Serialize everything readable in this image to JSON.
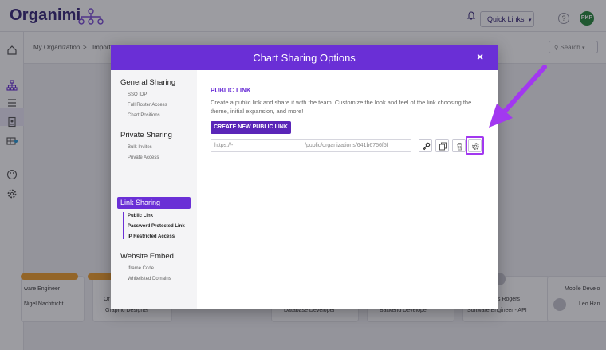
{
  "app": {
    "logo_text": "Organimi",
    "quick_links_label": "Quick Links",
    "help_glyph": "?",
    "user_initials": "PKP",
    "search_placeholder": "Search"
  },
  "breadcrumb": {
    "item1": "My Organization",
    "separator": ">",
    "item2": "Import"
  },
  "background_cards": {
    "c1_title": "ware Engineer",
    "c1_name": "Nigel Nachtricht",
    "c2_title": "Graphic Designer",
    "c2_name": "Or",
    "c3_title": "Database Developer",
    "c4_title": "Backend Developer",
    "c5_name": "s Rogers",
    "c5_title": "Software Engineer - API",
    "c6_title": "Mobile Develo",
    "c6_name": "Leo Han"
  },
  "modal": {
    "title": "Chart Sharing Options",
    "close_glyph": "×",
    "sidebar": {
      "general_heading": "General Sharing",
      "general_items": [
        "SSO IDP",
        "Full Roster Access",
        "Chart Positions"
      ],
      "private_heading": "Private Sharing",
      "private_items": [
        "Bulk Invites",
        "Private Access"
      ],
      "link_heading": "Link Sharing",
      "link_items": [
        "Public Link",
        "Password Protected Link",
        "IP Restricted Access"
      ],
      "embed_heading": "Website Embed",
      "embed_items": [
        "Iframe Code",
        "Whitelisted Domains"
      ]
    },
    "main": {
      "heading": "PUBLIC LINK",
      "description": "Create a public link and share it with the team. Customize the look and feel of the link choosing the theme, initial expansion, and more!",
      "create_button": "CREATE NEW PUBLIC LINK",
      "link_prefix": "https://-",
      "link_suffix": "/public/organizations/641b6756f5f"
    }
  },
  "icons": {
    "key": "key-icon",
    "copy": "copy-icon",
    "delete": "trash-icon",
    "settings": "gear-icon"
  },
  "colors": {
    "accent": "#6a2fd6",
    "button": "#5a25b8",
    "annotation": "#a238f0",
    "card_bar": "#f0a030"
  }
}
